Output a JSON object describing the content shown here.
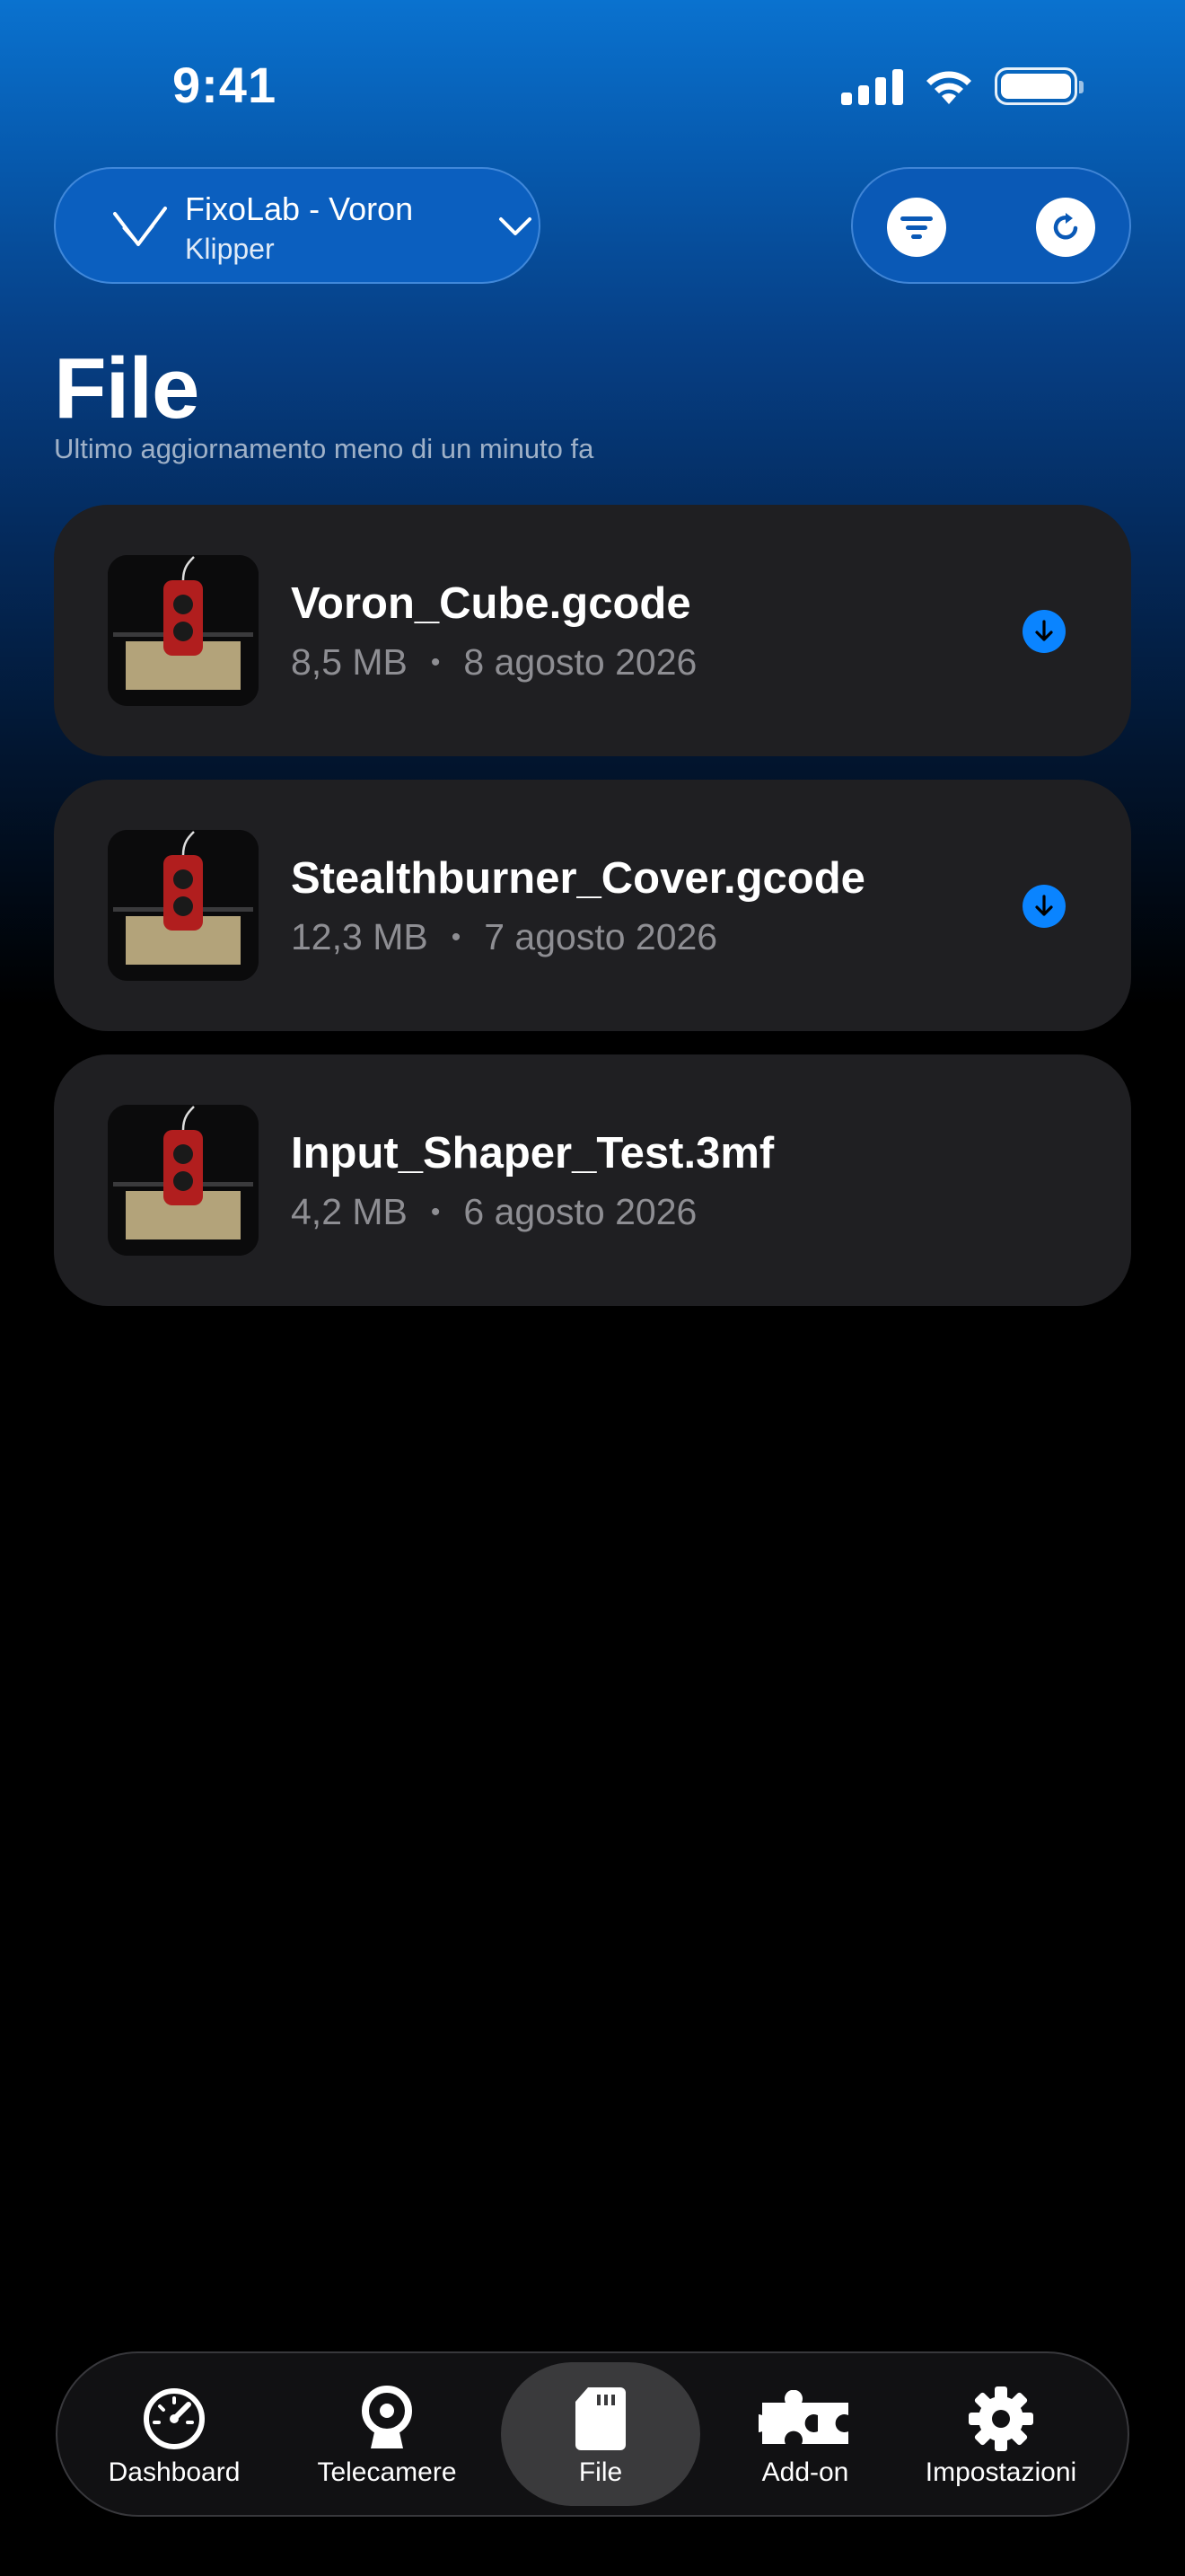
{
  "status_bar": {
    "time": "9:41",
    "icons": [
      "cellular-signal-icon",
      "wifi-icon",
      "battery-icon"
    ]
  },
  "printer_selector": {
    "name": "FixoLab - Voron",
    "firmware": "Klipper",
    "logo_icon": "voron-logo-icon",
    "chevron_icon": "chevron-down-icon"
  },
  "actions": {
    "filter_icon": "filter-icon",
    "refresh_icon": "refresh-icon"
  },
  "page": {
    "title": "File",
    "subtitle": "Ultimo aggiornamento meno di un minuto fa"
  },
  "files": [
    {
      "name": "Voron_Cube.gcode",
      "size": "8,5 MB",
      "date": "8 agosto 2026",
      "separator": "•",
      "downloadable": true
    },
    {
      "name": "Stealthburner_Cover.gcode",
      "size": "12,3 MB",
      "date": "7 agosto 2026",
      "separator": "•",
      "downloadable": true
    },
    {
      "name": "Input_Shaper_Test.3mf",
      "size": "4,2 MB",
      "date": "6 agosto 2026",
      "separator": "•",
      "downloadable": false
    }
  ],
  "tab_bar": {
    "active": "File",
    "tabs": [
      {
        "label": "Dashboard",
        "icon": "speedometer-icon"
      },
      {
        "label": "Telecamere",
        "icon": "webcam-icon"
      },
      {
        "label": "File",
        "icon": "sd-card-icon"
      },
      {
        "label": "Add-on",
        "icon": "puzzle-icon"
      },
      {
        "label": "Impostazioni",
        "icon": "gear-icon"
      }
    ]
  },
  "colors": {
    "accent": "#0a84ff",
    "card_bg": "#1f1f22",
    "secondary_text": "#8e8e93"
  }
}
